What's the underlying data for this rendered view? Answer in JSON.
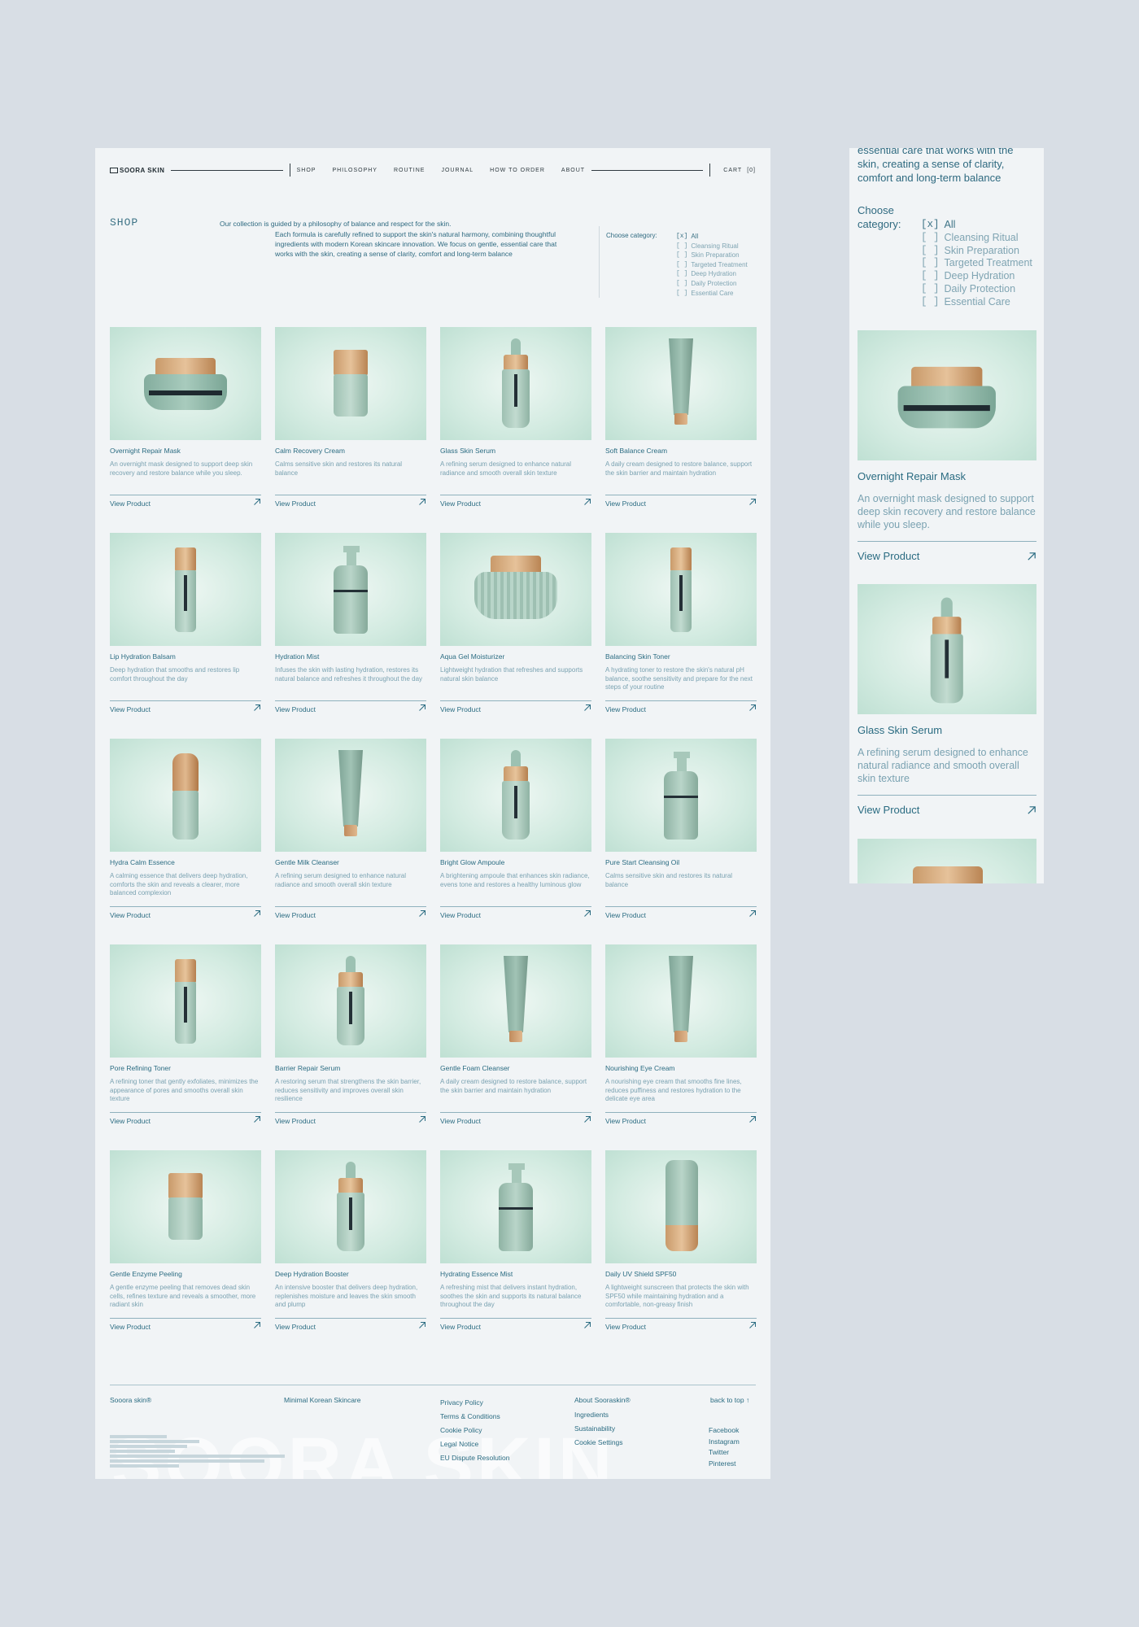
{
  "nav": {
    "logo": "SOORA SKIN",
    "links": [
      "SHOP",
      "PHILOSOPHY",
      "ROUTINE",
      "JOURNAL",
      "HOW TO ORDER",
      "ABOUT"
    ],
    "cart_label": "CART",
    "cart_count": "[0]"
  },
  "shop": {
    "title": "SHOP",
    "intro_line1": "Our collection is guided by a philosophy of balance and respect for the skin.",
    "intro_line2": "Each formula is carefully refined to support the skin's natural harmony, combining thoughtful ingredients with modern Korean skincare innovation. We focus on gentle, essential care that works with the skin, creating a sense of clarity, comfort and long-term balance"
  },
  "categories": {
    "label": "Choose category:",
    "items": [
      {
        "box": "[x]",
        "label": "All"
      },
      {
        "box": "[ ]",
        "label": "Cleansing Ritual"
      },
      {
        "box": "[ ]",
        "label": "Skin Preparation"
      },
      {
        "box": "[ ]",
        "label": "Targeted Treatment"
      },
      {
        "box": "[ ]",
        "label": "Deep Hydration"
      },
      {
        "box": "[ ]",
        "label": "Daily Protection"
      },
      {
        "box": "[ ]",
        "label": "Essential Care"
      }
    ]
  },
  "view_label": "View Product",
  "products": [
    {
      "name": "Overnight Repair Mask",
      "desc": "An overnight mask designed to support deep skin recovery and restore balance while you sleep.",
      "shape": "jar"
    },
    {
      "name": "Calm Recovery Cream",
      "desc": "Calms sensitive skin and restores its natural balance",
      "shape": "tall-jar"
    },
    {
      "name": "Glass Skin Serum",
      "desc": "A refining serum designed to enhance natural radiance and smooth overall skin texture",
      "shape": "dropper"
    },
    {
      "name": "Soft Balance Cream",
      "desc": "A daily cream designed to restore balance, support the skin barrier and maintain hydration",
      "shape": "tube"
    },
    {
      "name": "Lip Hydration Balsam",
      "desc": "Deep hydration that smooths and restores lip comfort throughout the day",
      "shape": "slim"
    },
    {
      "name": "Hydration Mist",
      "desc": "Infuses the skin with lasting hydration, restores its natural balance and refreshes it throughout the day",
      "shape": "pump"
    },
    {
      "name": "Aqua Gel Moisturizer",
      "desc": "Lightweight hydration that refreshes and supports natural skin balance",
      "shape": "big-jar"
    },
    {
      "name": "Balancing Skin Toner",
      "desc": "A hydrating toner to restore the skin's natural pH balance, soothe sensitivity and prepare for the next steps of your routine",
      "shape": "slim"
    },
    {
      "name": "Hydra Calm Essence",
      "desc": "A calming essence that delivers deep hydration, comforts the skin and reveals a clearer, more balanced complexion",
      "shape": "essence"
    },
    {
      "name": "Gentle Milk Cleanser",
      "desc": "A refining serum designed to enhance natural radiance and smooth overall skin texture",
      "shape": "tube"
    },
    {
      "name": "Bright Glow Ampoule",
      "desc": "A brightening ampoule that enhances skin radiance, evens tone and restores a healthy luminous glow",
      "shape": "dropper"
    },
    {
      "name": "Pure Start Cleansing Oil",
      "desc": "Calms sensitive skin and restores its natural balance",
      "shape": "pump"
    },
    {
      "name": "Pore Refining Toner",
      "desc": "A refining toner that gently exfoliates, minimizes the appearance of pores and smooths overall skin texture",
      "shape": "slim"
    },
    {
      "name": "Barrier Repair Serum",
      "desc": "A restoring serum that strengthens the skin barrier, reduces sensitivity and improves overall skin resilience",
      "shape": "dropper"
    },
    {
      "name": "Gentle Foam Cleanser",
      "desc": "A daily cream designed to restore balance, support the skin barrier and maintain hydration",
      "shape": "tube"
    },
    {
      "name": "Nourishing Eye Cream",
      "desc": "A nourishing eye cream that smooths fine lines, reduces puffiness and restores hydration to the delicate eye area",
      "shape": "tube"
    },
    {
      "name": "Gentle Enzyme Peeling",
      "desc": "A gentle enzyme peeling that removes dead skin cells, refines texture and reveals a smoother, more radiant skin",
      "shape": "tall-jar"
    },
    {
      "name": "Deep Hydration Booster",
      "desc": "An intensive booster that delivers deep hydration, replenishes moisture and leaves the skin smooth and plump",
      "shape": "dropper"
    },
    {
      "name": "Hydrating Essence Mist",
      "desc": "A refreshing mist that delivers instant hydration, soothes the skin and supports its natural balance throughout the day",
      "shape": "pump"
    },
    {
      "name": "Daily UV Shield SPF50",
      "desc": "A lightweight sunscreen that protects the skin with SPF50 while maintaining hydration and a comfortable, non-greasy finish",
      "shape": "spf"
    }
  ],
  "footer": {
    "brand": "Sooora skin®",
    "tagline": "Minimal Korean Skincare",
    "legal": [
      "Privacy Policy",
      "Terms & Conditions",
      "Cookie Policy",
      "Legal Notice",
      "EU Dispute Resolution"
    ],
    "about": [
      "About Sooraskin®",
      "Ingredients",
      "Sustainability",
      "Cookie Settings"
    ],
    "back_to_top": "back to top ↑",
    "social": [
      "Facebook",
      "Instagram",
      "Twitter",
      "Pinterest"
    ],
    "big_logo": "SOORA SKIN"
  },
  "mobile": {
    "intro": "essential care that works with the skin, creating a sense of clarity, comfort and long-term balance",
    "cat_label": "Choose category:",
    "cards": [
      {
        "name": "Overnight Repair Mask",
        "desc": "An overnight mask designed to support deep skin recovery and restore balance while you sleep.",
        "shape": "jar"
      },
      {
        "name": "Glass Skin Serum",
        "desc": "A refining serum designed to enhance natural radiance and smooth overall skin texture",
        "shape": "dropper"
      }
    ]
  }
}
